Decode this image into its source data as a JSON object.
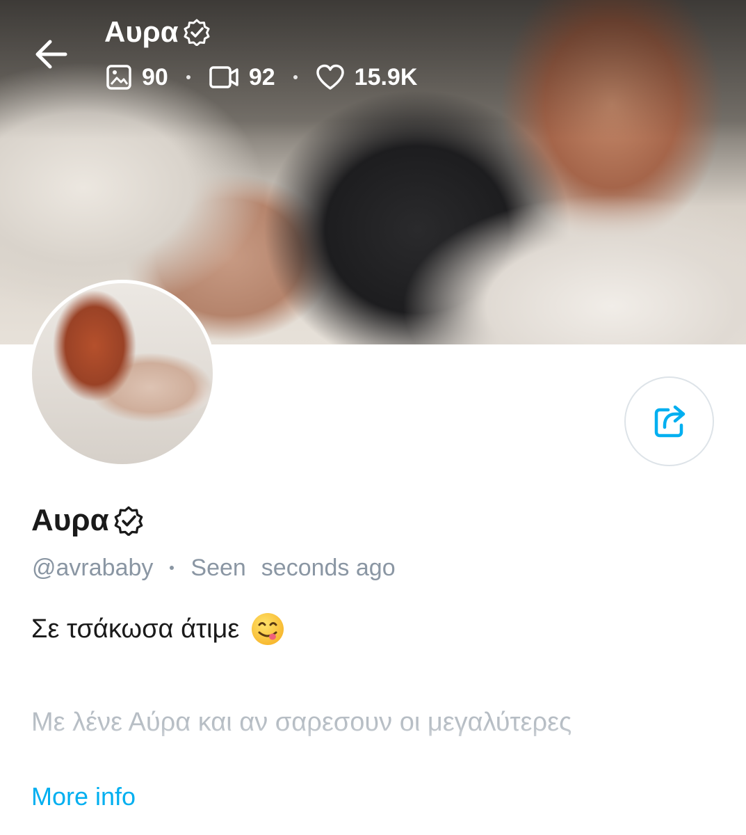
{
  "header": {
    "name": "Αυρα",
    "photos_count": "90",
    "videos_count": "92",
    "likes_count": "15.9K",
    "icons": {
      "back": "arrow-left-icon",
      "photos": "image-icon",
      "videos": "video-camera-icon",
      "likes": "heart-icon",
      "verified": "verified-badge-icon"
    }
  },
  "profile": {
    "display_name": "Αυρα",
    "handle": "@avrababy",
    "seen_label": "Seen",
    "seen_time": "seconds ago",
    "bio_first_line": "Σε τσάκωσα άτιμε",
    "bio_second_paragraph": "Με λένε Αύρα και αν σαρεσουν οι μεγαλύτερες",
    "more_info_label": "More info",
    "share_icon": "share-icon"
  },
  "colors": {
    "accent": "#00aff0",
    "muted_text": "#8a96a3",
    "primary_text": "#1a1a1a"
  }
}
